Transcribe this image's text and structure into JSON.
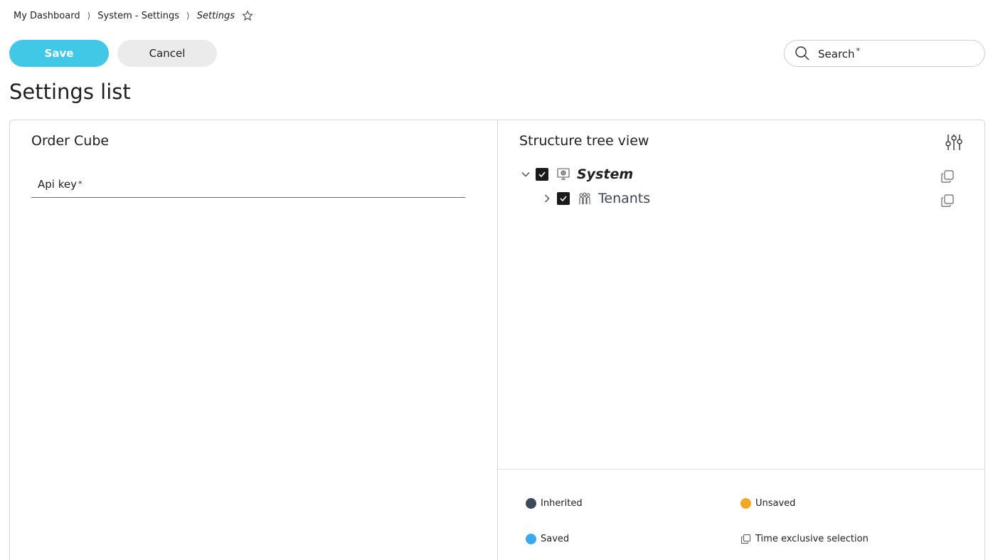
{
  "breadcrumb": {
    "items": [
      "My Dashboard",
      "System - Settings",
      "Settings"
    ],
    "separator": "⟩",
    "favorite_icon": "star-outline-icon"
  },
  "toolbar": {
    "save_label": "Save",
    "cancel_label": "Cancel",
    "save_color": "#40c8e6"
  },
  "search": {
    "label": "Search",
    "required_mark": "*",
    "icon": "search-icon"
  },
  "page": {
    "title": "Settings list"
  },
  "left_section": {
    "title": "Order Cube",
    "api_key_label": "Api key",
    "api_key_required": "*",
    "api_key_value": ""
  },
  "tree": {
    "title": "Structure tree view",
    "settings_icon": "sliders-icon",
    "nodes": [
      {
        "label": "System",
        "checked": true,
        "expanded": true,
        "icon": "monitor-icon"
      },
      {
        "label": "Tenants",
        "checked": true,
        "expanded": false,
        "icon": "people-icon"
      }
    ]
  },
  "legend": {
    "inherited": {
      "label": "Inherited",
      "color": "#3e4a5c"
    },
    "unsaved": {
      "label": "Unsaved",
      "color": "#f5a623"
    },
    "saved": {
      "label": "Saved",
      "color": "#3aa9f0"
    },
    "time_exclusive": {
      "label": "Time exclusive selection",
      "icon": "copy-icon"
    }
  }
}
